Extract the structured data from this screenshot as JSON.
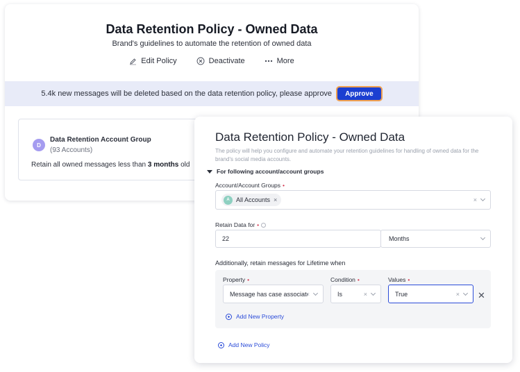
{
  "back_card": {
    "title": "Data Retention Policy - Owned Data",
    "subtitle": "Brand's guidelines to automate the retention of owned data",
    "actions": {
      "edit": "Edit Policy",
      "deactivate": "Deactivate",
      "more": "More"
    },
    "banner": {
      "text": "5.4k new messages will be deleted based on the data retention policy, please approve",
      "approve": "Approve"
    },
    "group": {
      "avatar": "D",
      "name": "Data Retention Account Group",
      "count": "(93 Accounts)",
      "retain_prefix": "Retain all owned messages less than",
      "retain_value": "3 months",
      "retain_suffix": "old"
    }
  },
  "front_card": {
    "title": "Data Retention Policy - Owned Data",
    "description": "The policy will help you configure and automate your retention guidelines for handling of owned data for the brand's social media accounts.",
    "section": "For following account/account groups",
    "account_groups": {
      "label": "Account/Account Groups",
      "chip_avatar": "A",
      "chip_label": "All Accounts"
    },
    "retain": {
      "label": "Retain Data for",
      "value": "22",
      "unit": "Months"
    },
    "lifetime": {
      "label": "Additionally, retain messages for Lifetime when",
      "property_label": "Property",
      "property_value": "Message has case associated",
      "condition_label": "Condition",
      "condition_value": "Is",
      "values_label": "Values",
      "values_value": "True",
      "add_property": "Add New Property"
    },
    "add_policy": "Add New Policy"
  },
  "colors": {
    "accent": "#1b3fd1",
    "banner_bg": "#e8ebf8",
    "link": "#2a4bd8",
    "required": "#d3324b"
  },
  "icons": {
    "edit": "pencil-icon",
    "deactivate": "circle-x-icon",
    "more": "ellipsis-icon",
    "collapse": "caret-down-icon",
    "add": "plus-circle-icon",
    "remove": "close-icon"
  }
}
